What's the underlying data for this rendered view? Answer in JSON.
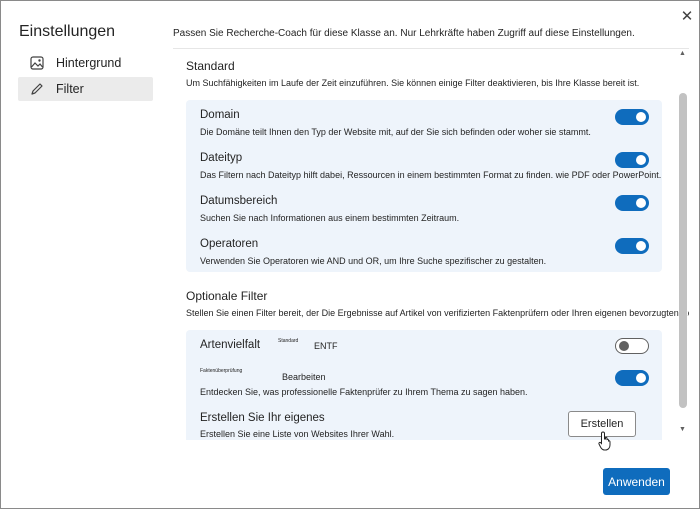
{
  "dialog": {
    "title": "Einstellungen",
    "close_glyph": "✕"
  },
  "sidebar": {
    "items": [
      {
        "label": "Hintergrund",
        "icon": "image-icon",
        "selected": false
      },
      {
        "label": "Filter",
        "icon": "pencil-icon",
        "selected": true
      }
    ]
  },
  "main": {
    "intro": "Passen Sie Recherche-Coach für diese Klasse an. Nur Lehrkräfte haben Zugriff auf diese Einstellungen.",
    "standard": {
      "title": "Standard",
      "desc": "Um Suchfähigkeiten im Laufe der Zeit einzuführen. Sie können einige Filter deaktivieren, bis Ihre Klasse bereit ist.",
      "items": [
        {
          "title": "Domain",
          "desc": "Die Domäne teilt Ihnen den Typ der Website mit, auf der Sie sich befinden oder woher sie stammt.",
          "on": true
        },
        {
          "title": "Dateityp",
          "desc": "Das Filtern nach Dateityp hilft dabei, Ressourcen in einem bestimmten Format zu finden. wie PDF oder PowerPoint.",
          "on": true
        },
        {
          "title": "Datumsbereich",
          "desc": "Suchen Sie nach Informationen aus einem bestimmten Zeitraum.",
          "on": true
        },
        {
          "title": "Operatoren",
          "desc": "Verwenden Sie Operatoren wie AND und OR, um Ihre Suche spezifischer zu gestalten.",
          "on": true
        }
      ]
    },
    "optional": {
      "title": "Optionale Filter",
      "desc": "Stellen Sie einen Filter bereit, der Die Ergebnisse auf Artikel von verifizierten Faktenprüfern oder Ihren eigenen bevorzugten Ressourcen beschränkt.",
      "artenvielfalt": {
        "title": "Artenvielfalt",
        "tiny": "Standard",
        "label": "ENTF",
        "on": false
      },
      "fakten": {
        "tiny": "Faktenüberprüfung",
        "label": "Bearbeiten",
        "desc": "Entdecken Sie, was professionelle Faktenprüfer zu Ihrem Thema zu sagen haben.",
        "on": true
      },
      "eigenes": {
        "title": "Erstellen Sie Ihr eigenes",
        "desc": "Erstellen Sie eine Liste von Websites Ihrer Wahl.",
        "button": "Erstellen"
      }
    }
  },
  "footer": {
    "apply_label": "Anwenden"
  },
  "colors": {
    "accent": "#0f6cbd",
    "card_bg": "#eef4fb",
    "selected_nav": "#ebebeb"
  }
}
